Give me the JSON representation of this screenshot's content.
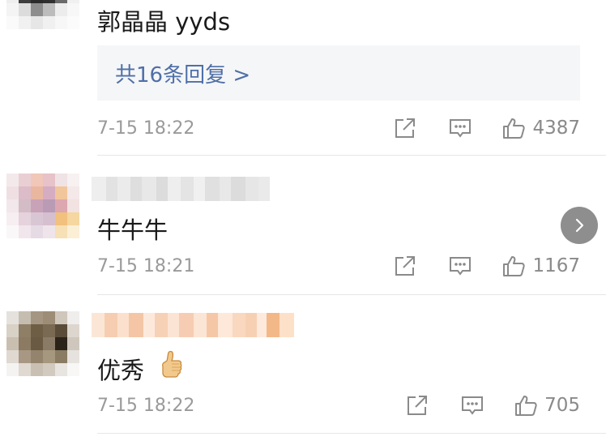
{
  "comments": [
    {
      "text": "郭晶晶 yyds",
      "reply_summary": "共16条回复 >",
      "time": "7-15 18:22",
      "likes": "4387",
      "icons": [
        "share-icon",
        "comment-icon",
        "like-icon"
      ]
    },
    {
      "text": "牛牛牛",
      "time": "7-15 18:21",
      "likes": "1167",
      "icons": [
        "share-icon",
        "comment-icon",
        "like-icon"
      ]
    },
    {
      "text": "优秀",
      "time": "7-15 18:22",
      "likes": "705",
      "icons": [
        "share-icon",
        "comment-icon",
        "like-icon",
        "thumbs-up-emoji"
      ]
    }
  ],
  "colors": {
    "reply_link": "#4f6fa8",
    "meta_text": "#9a9a9a",
    "reply_bg": "#f5f6f7",
    "next_button": "#8e8e8e"
  },
  "next_button_icon": "chevron-right-icon"
}
